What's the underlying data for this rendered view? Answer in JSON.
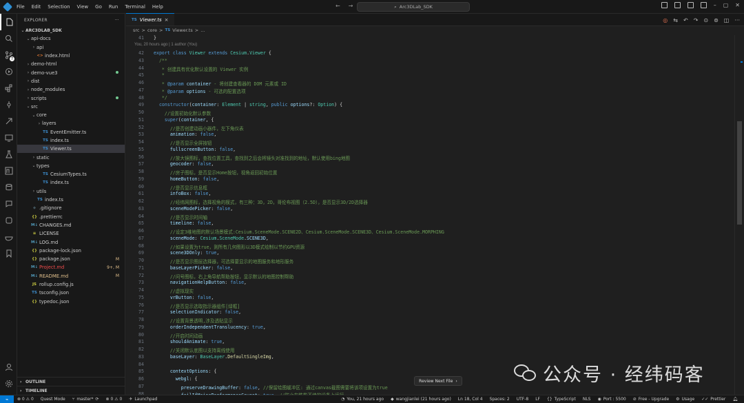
{
  "window": {
    "menu": [
      "File",
      "Edit",
      "Selection",
      "View",
      "Go",
      "Run",
      "Terminal",
      "Help"
    ],
    "search_text": "Arc3DLab_SDK",
    "nav_back": "←",
    "nav_forward": "→"
  },
  "explorer": {
    "title": "EXPLORER",
    "more": "···",
    "root": "ARC3DLAB_SDK",
    "items": [
      {
        "label": "api-docs",
        "kind": "folder",
        "open": true,
        "depth": 1
      },
      {
        "label": "api",
        "kind": "folder",
        "open": false,
        "depth": 2
      },
      {
        "label": "index.html",
        "kind": "html",
        "depth": 2
      },
      {
        "label": "demo-html",
        "kind": "folder",
        "open": false,
        "depth": 1
      },
      {
        "label": "demo-vue3",
        "kind": "folder",
        "open": false,
        "depth": 1,
        "dot": true
      },
      {
        "label": "dist",
        "kind": "folder",
        "open": false,
        "depth": 1
      },
      {
        "label": "node_modules",
        "kind": "folder",
        "open": false,
        "depth": 1
      },
      {
        "label": "scripts",
        "kind": "folder",
        "open": false,
        "depth": 1,
        "dot": true
      },
      {
        "label": "src",
        "kind": "folder",
        "open": true,
        "depth": 1
      },
      {
        "label": "core",
        "kind": "folder",
        "open": true,
        "depth": 2
      },
      {
        "label": "layers",
        "kind": "folder",
        "open": false,
        "depth": 3
      },
      {
        "label": "EventEmitter.ts",
        "kind": "ts",
        "depth": 3
      },
      {
        "label": "index.ts",
        "kind": "ts",
        "depth": 3
      },
      {
        "label": "Viewer.ts",
        "kind": "ts",
        "depth": 3,
        "selected": true
      },
      {
        "label": "static",
        "kind": "folder",
        "open": false,
        "depth": 2
      },
      {
        "label": "types",
        "kind": "folder",
        "open": true,
        "depth": 2
      },
      {
        "label": "CesiumTypes.ts",
        "kind": "ts",
        "depth": 3
      },
      {
        "label": "index.ts",
        "kind": "ts",
        "depth": 3
      },
      {
        "label": "utils",
        "kind": "folder",
        "open": false,
        "depth": 2
      },
      {
        "label": "index.ts",
        "kind": "ts",
        "depth": 2
      },
      {
        "label": ".gitignore",
        "kind": "git",
        "depth": 1
      },
      {
        "label": ".prettierrc",
        "kind": "json",
        "depth": 1
      },
      {
        "label": "CHANGES.md",
        "kind": "md",
        "depth": 1
      },
      {
        "label": "LICENSE",
        "kind": "license",
        "depth": 1
      },
      {
        "label": "LOG.md",
        "kind": "md",
        "depth": 1
      },
      {
        "label": "package-lock.json",
        "kind": "json",
        "depth": 1
      },
      {
        "label": "package.json",
        "kind": "json",
        "depth": 1,
        "mark": "M",
        "markColor": "#e2c08d"
      },
      {
        "label": "Project.md",
        "kind": "md",
        "depth": 1,
        "mark": "9+, M",
        "markColor": "#e2c08d",
        "labelColor": "#f14c4c"
      },
      {
        "label": "README.md",
        "kind": "md",
        "depth": 1,
        "mark": "M",
        "markColor": "#e2c08d",
        "labelColor": "#e2c08d"
      },
      {
        "label": "rollup.config.js",
        "kind": "js",
        "depth": 1
      },
      {
        "label": "tsconfig.json",
        "kind": "ts",
        "depth": 1
      },
      {
        "label": "typedoc.json",
        "kind": "json",
        "depth": 1
      }
    ],
    "outline": "OUTLINE",
    "timeline": "TIMELINE"
  },
  "editor": {
    "tab": {
      "icon": "TS",
      "label": "Viewer.ts",
      "close": "×"
    },
    "breadcrumb": [
      "src",
      ">",
      "core",
      ">",
      "TS",
      "Viewer.ts",
      ">",
      "..."
    ],
    "blame": "You, 20 hours ago | 1 author (You)",
    "lines": [
      {
        "n": "41",
        "h": "<span class='pu'>}</span>"
      },
      {
        "n": "42",
        "h": "<span class='kw'>export</span> <span class='kw'>class</span> <span class='cls'>Viewer</span> <span class='kw'>extends</span> <span class='cls'>Cesium</span>.<span class='cls'>Viewer</span> {"
      },
      {
        "n": "43",
        "h": "  <span class='cm'>/**</span>"
      },
      {
        "n": "44",
        "h": "  <span class='cm'> * 创建具有优化默认设置的 Viewer 实例</span>"
      },
      {
        "n": "45",
        "h": "  <span class='cm'> *</span>"
      },
      {
        "n": "46",
        "h": "  <span class='cm'> * </span><span class='tg'>@param</span><span class='cm'> </span><span class='pr'>container</span><span class='cm'> - 将创建查看器的 DOM 元素或 ID</span>"
      },
      {
        "n": "47",
        "h": "  <span class='cm'> * </span><span class='tg'>@param</span><span class='cm'> </span><span class='pr'>options</span><span class='cm'> - 可选的配置选项</span>"
      },
      {
        "n": "48",
        "h": "  <span class='cm'> */</span>"
      },
      {
        "n": "49",
        "h": "  <span class='kw'>constructor</span>(<span class='pr'>container</span>: <span class='ty'>Element</span> | <span class='ty'>string</span>, <span class='kw'>public</span> <span class='pr'>options</span>?: <span class='ty'>Option</span>) {"
      },
      {
        "n": "50",
        "h": "    <span class='cm'>//设置初始化默认参数</span>"
      },
      {
        "n": "51",
        "h": "    <span class='kw'>super</span>(<span class='pr'>container</span>, {"
      },
      {
        "n": "52",
        "h": "      <span class='cm'>//是否创建动画小器件，左下角仪表</span>"
      },
      {
        "n": "53",
        "h": "      <span class='pr'>animation</span>: <span class='bo'>false</span>,"
      },
      {
        "n": "54",
        "h": "      <span class='cm'>//是否显示全屏按钮</span>"
      },
      {
        "n": "55",
        "h": "      <span class='pr'>fullscreenButton</span>: <span class='bo'>false</span>,"
      },
      {
        "n": "56",
        "h": "      <span class='cm'>//放大镜图标，查找位置工具，查找到之后会将镜头对准找到的地址，默认使用bing地图</span>"
      },
      {
        "n": "57",
        "h": "      <span class='pr'>geocoder</span>: <span class='bo'>false</span>,"
      },
      {
        "n": "58",
        "h": "      <span class='cm'>//房子图标，是否显示Home按钮，视角返回初始位置</span>"
      },
      {
        "n": "59",
        "h": "      <span class='pr'>homeButton</span>: <span class='bo'>false</span>,"
      },
      {
        "n": "60",
        "h": "      <span class='cm'>//是否显示信息框</span>"
      },
      {
        "n": "61",
        "h": "      <span class='pr'>infoBox</span>: <span class='bo'>false</span>,"
      },
      {
        "n": "62",
        "h": "      <span class='cm'>//经纬网图标，选择视角的模式，有三种：3D，2D，哥伦布视图（2.5D），是否显示3D/2D选择器</span>"
      },
      {
        "n": "63",
        "h": "      <span class='pr'>sceneModePicker</span>: <span class='bo'>false</span>,"
      },
      {
        "n": "64",
        "h": "      <span class='cm'>//是否显示时间轴</span>"
      },
      {
        "n": "65",
        "h": "      <span class='pr'>timeline</span>: <span class='bo'>false</span>,"
      },
      {
        "n": "66",
        "h": "      <span class='cm'>//设定3维地图的默认场景模式:Cesium.SceneMode.SCENE2D、Cesium.SceneMode.SCENE3D、Cesium.SceneMode.MORPHING</span>"
      },
      {
        "n": "67",
        "h": "      <span class='pr'>sceneMode</span>: <span class='cls'>Cesium</span>.<span class='cls'>SceneMode</span>.<span class='pr'>SCENE3D</span>,"
      },
      {
        "n": "68",
        "h": "      <span class='cm'>//如果设置为true，则所有几何图形以3D模式绘制以节约GPU资源</span>"
      },
      {
        "n": "69",
        "h": "      <span class='pr'>scene3DOnly</span>: <span class='bo'>true</span>,"
      },
      {
        "n": "70",
        "h": "      <span class='cm'>//是否显示图层选择器，可选择要显示的地图服务和地形服务</span>"
      },
      {
        "n": "71",
        "h": "      <span class='pr'>baseLayerPicker</span>: <span class='bo'>false</span>,"
      },
      {
        "n": "72",
        "h": "      <span class='cm'>//问号图标，右上角导航帮助按钮，显示默认的地图控制帮助</span>"
      },
      {
        "n": "73",
        "h": "      <span class='pr'>navigationHelpButton</span>: <span class='bo'>false</span>,"
      },
      {
        "n": "74",
        "h": "      <span class='cm'>//虚拟现实</span>"
      },
      {
        "n": "75",
        "h": "      <span class='pr'>vrButton</span>: <span class='bo'>false</span>,"
      },
      {
        "n": "76",
        "h": "      <span class='cm'>//是否显示选取指示器组件[绿框]</span>"
      },
      {
        "n": "77",
        "h": "      <span class='pr'>selectionIndicator</span>: <span class='bo'>false</span>,"
      },
      {
        "n": "78",
        "h": "      <span class='cm'>//设置背景透明,涉及透贴显示</span>"
      },
      {
        "n": "79",
        "h": "      <span class='pr'>orderIndependentTranslucency</span>: <span class='bo'>true</span>,"
      },
      {
        "n": "80",
        "h": "      <span class='cm'>//开启时间动画</span>"
      },
      {
        "n": "81",
        "h": "      <span class='pr'>shouldAnimate</span>: <span class='bo'>true</span>,"
      },
      {
        "n": "82",
        "h": "      <span class='cm'>//关闭默认底图以支持离线使用</span>"
      },
      {
        "n": "83",
        "h": "      <span class='pr'>baseLayer</span>: <span class='cls'>BaseLayer</span>.<span class='fn'>DefaultSingleImg</span>,"
      },
      {
        "n": "84",
        "h": ""
      },
      {
        "n": "85",
        "h": "      <span class='pr'>contextOptions</span>: {"
      },
      {
        "n": "86",
        "h": "        <span class='pr'>webgl</span>: {"
      },
      {
        "n": "87",
        "h": "          <span class='pr'>preserveDrawingBuffer</span>: <span class='bo'>false</span>, <span class='cm'>//保留绘图缓冲区: 通过canvas截图需要将该项设置为true</span>"
      },
      {
        "n": "88",
        "h": "          <span class='pr'>failIfMajorPerformanceCaveat</span>: <span class='bo'>true</span>, <span class='cm'>//防止在性能不佳的设备上运行</span>"
      }
    ],
    "review": "Review Next File",
    "review_arrow": "›"
  },
  "watermark": "公众号 · 经纬码客",
  "status": {
    "errors": "⊗ 0 ⚠ 0",
    "quest": "Quest Mode",
    "branch": "master*",
    "sync": "⟳",
    "warnings": "⊗ 0 ⚠ 0",
    "launchpad": "Launchpad",
    "blame": "You, 21 hours ago",
    "author": "wangjianlei (21 hours ago)",
    "pos": "Ln 18, Col 4",
    "spaces": "Spaces: 2",
    "enc": "UTF-8",
    "eol": "LF",
    "lang": "TypeScript",
    "nls": "NLS",
    "port": "Port : 5500",
    "upgrade": "Free - Upgrade",
    "usage": "Usage",
    "prettier": "Prettier"
  },
  "colors": {
    "accent": "#0078d4",
    "modified": "#e2c08d",
    "error": "#f14c4c",
    "untracked": "#73c991"
  }
}
